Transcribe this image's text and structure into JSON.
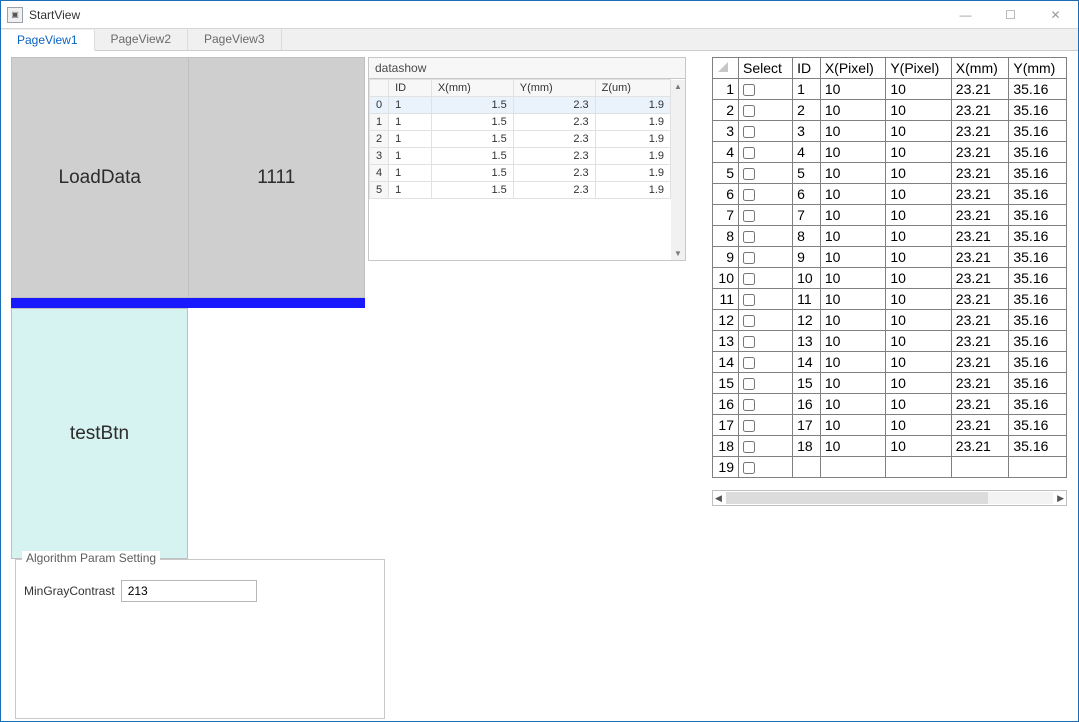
{
  "window": {
    "title": "StartView",
    "icon_label": "▣"
  },
  "tabs": [
    {
      "label": "PageView1",
      "active": true
    },
    {
      "label": "PageView2",
      "active": false
    },
    {
      "label": "PageView3",
      "active": false
    }
  ],
  "buttons": {
    "load_data": "LoadData",
    "one_one_one": "1111",
    "test_btn": "testBtn"
  },
  "datashow": {
    "title": "datashow",
    "columns": [
      "ID",
      "X(mm)",
      "Y(mm)",
      "Z(um)"
    ],
    "rows": [
      {
        "idx": "0",
        "id": "1",
        "xmm": "1.5",
        "ymm": "2.3",
        "zum": "1.9",
        "selected": true
      },
      {
        "idx": "1",
        "id": "1",
        "xmm": "1.5",
        "ymm": "2.3",
        "zum": "1.9",
        "selected": false
      },
      {
        "idx": "2",
        "id": "1",
        "xmm": "1.5",
        "ymm": "2.3",
        "zum": "1.9",
        "selected": false
      },
      {
        "idx": "3",
        "id": "1",
        "xmm": "1.5",
        "ymm": "2.3",
        "zum": "1.9",
        "selected": false
      },
      {
        "idx": "4",
        "id": "1",
        "xmm": "1.5",
        "ymm": "2.3",
        "zum": "1.9",
        "selected": false
      },
      {
        "idx": "5",
        "id": "1",
        "xmm": "1.5",
        "ymm": "2.3",
        "zum": "1.9",
        "selected": false
      }
    ]
  },
  "grid": {
    "columns": [
      "Select",
      "ID",
      "X(Pixel)",
      "Y(Pixel)",
      "X(mm)",
      "Y(mm)"
    ],
    "rows": [
      {
        "n": "1",
        "id": "1",
        "xp": "10",
        "yp": "10",
        "xmm": "23.21",
        "ymm": "35.16"
      },
      {
        "n": "2",
        "id": "2",
        "xp": "10",
        "yp": "10",
        "xmm": "23.21",
        "ymm": "35.16"
      },
      {
        "n": "3",
        "id": "3",
        "xp": "10",
        "yp": "10",
        "xmm": "23.21",
        "ymm": "35.16"
      },
      {
        "n": "4",
        "id": "4",
        "xp": "10",
        "yp": "10",
        "xmm": "23.21",
        "ymm": "35.16"
      },
      {
        "n": "5",
        "id": "5",
        "xp": "10",
        "yp": "10",
        "xmm": "23.21",
        "ymm": "35.16"
      },
      {
        "n": "6",
        "id": "6",
        "xp": "10",
        "yp": "10",
        "xmm": "23.21",
        "ymm": "35.16"
      },
      {
        "n": "7",
        "id": "7",
        "xp": "10",
        "yp": "10",
        "xmm": "23.21",
        "ymm": "35.16"
      },
      {
        "n": "8",
        "id": "8",
        "xp": "10",
        "yp": "10",
        "xmm": "23.21",
        "ymm": "35.16"
      },
      {
        "n": "9",
        "id": "9",
        "xp": "10",
        "yp": "10",
        "xmm": "23.21",
        "ymm": "35.16"
      },
      {
        "n": "10",
        "id": "10",
        "xp": "10",
        "yp": "10",
        "xmm": "23.21",
        "ymm": "35.16"
      },
      {
        "n": "11",
        "id": "11",
        "xp": "10",
        "yp": "10",
        "xmm": "23.21",
        "ymm": "35.16"
      },
      {
        "n": "12",
        "id": "12",
        "xp": "10",
        "yp": "10",
        "xmm": "23.21",
        "ymm": "35.16"
      },
      {
        "n": "13",
        "id": "13",
        "xp": "10",
        "yp": "10",
        "xmm": "23.21",
        "ymm": "35.16"
      },
      {
        "n": "14",
        "id": "14",
        "xp": "10",
        "yp": "10",
        "xmm": "23.21",
        "ymm": "35.16"
      },
      {
        "n": "15",
        "id": "15",
        "xp": "10",
        "yp": "10",
        "xmm": "23.21",
        "ymm": "35.16"
      },
      {
        "n": "16",
        "id": "16",
        "xp": "10",
        "yp": "10",
        "xmm": "23.21",
        "ymm": "35.16"
      },
      {
        "n": "17",
        "id": "17",
        "xp": "10",
        "yp": "10",
        "xmm": "23.21",
        "ymm": "35.16"
      },
      {
        "n": "18",
        "id": "18",
        "xp": "10",
        "yp": "10",
        "xmm": "23.21",
        "ymm": "35.16"
      },
      {
        "n": "19",
        "id": "",
        "xp": "",
        "yp": "",
        "xmm": "",
        "ymm": ""
      }
    ]
  },
  "param_group": {
    "title": "Algorithm Param Setting",
    "min_gray_contrast_label": "MinGrayContrast",
    "min_gray_contrast_value": "213"
  },
  "window_controls": {
    "minimize": "—",
    "maximize": "☐",
    "close": "✕"
  }
}
